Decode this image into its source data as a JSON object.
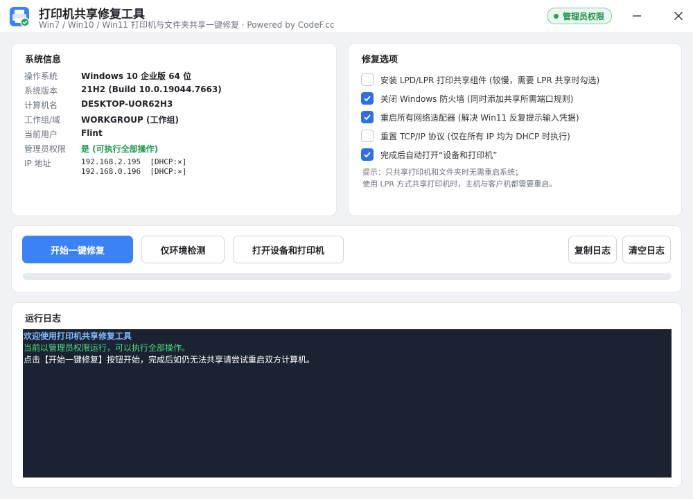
{
  "window": {
    "title": "打印机共享修复工具",
    "subtitle": "Win7 / Win10 / Win11 打印机与文件夹共享一键修复 · Powered by CodeF.cc",
    "admin_badge": "管理员权限",
    "icons": {
      "app": "printer-shield-icon",
      "minimize": "minimize-icon",
      "close": "close-icon"
    }
  },
  "system_info": {
    "title": "系统信息",
    "rows": [
      {
        "label": "操作系统",
        "value": "Windows 10 企业版 64 位"
      },
      {
        "label": "系统版本",
        "value": "21H2 (Build 10.0.19044.7663)"
      },
      {
        "label": "计算机名",
        "value": "DESKTOP-UOR62H3"
      },
      {
        "label": "工作组/域",
        "value": "WORKGROUP (工作组)"
      },
      {
        "label": "当前用户",
        "value": "Flint"
      },
      {
        "label": "管理员权限",
        "value": "是 (可执行全部操作)"
      }
    ],
    "ip_label": "IP 地址",
    "ip_lines": [
      "192.168.2.195  [DHCP:×]",
      "192.168.0.196  [DHCP:×]"
    ]
  },
  "repair_options": {
    "title": "修复选项",
    "options": [
      {
        "label": "安装 LPD/LPR 打印共享组件 (较慢，需要 LPR 共享时勾选)",
        "checked": false
      },
      {
        "label": "关闭 Windows 防火墙 (同时添加共享所需端口规则)",
        "checked": true
      },
      {
        "label": "重启所有网络适配器 (解决 Win11 反复提示输入凭据)",
        "checked": true
      },
      {
        "label": "重置 TCP/IP 协议 (仅在所有 IP 均为 DHCP 时执行)",
        "checked": false
      },
      {
        "label": "完成后自动打开“设备和打印机”",
        "checked": true
      }
    ],
    "hint_lines": [
      "提示：只共享打印机和文件夹时无需重启系统；",
      "使用 LPR 方式共享打印机时，主机与客户机都需要重启。"
    ]
  },
  "actions": {
    "start": "开始一键修复",
    "check_env": "仅环境检测",
    "open_devices": "打开设备和打印机",
    "copy_log": "复制日志",
    "clear_log": "清空日志",
    "progress": 0
  },
  "log": {
    "title": "运行日志",
    "lines": [
      "欢迎使用打印机共享修复工具",
      "当前以管理员权限运行，可以执行全部操作。",
      "点击【开始一键修复】按钮开始，完成后如仍无法共享请尝试重启双方计算机。"
    ]
  },
  "colors": {
    "primary": "#3b82f6",
    "admin_green": "#1e8f4c",
    "log_bg": "#1b2332",
    "log_title": "#7fb8ff",
    "log_success": "#4ade80"
  }
}
